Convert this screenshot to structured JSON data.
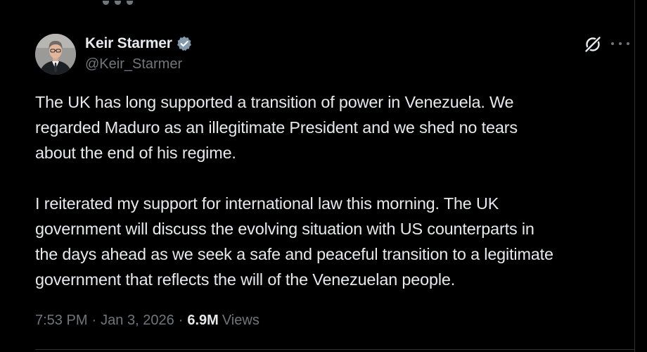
{
  "author": {
    "display_name": "Keir Starmer",
    "handle": "@Keir_Starmer",
    "verified": true,
    "avatar_icon": "profile-photo"
  },
  "header_icons": {
    "grok": "grok-icon",
    "more": "more-options-icon"
  },
  "tweet": {
    "paragraphs": [
      "The UK has long supported a transition of power in Venezuela. We\nregarded Maduro as an illegitimate President and we shed no tears\nabout the end of his regime.",
      "I reiterated my support for international law this morning. The UK\ngovernment will discuss the evolving situation with US counterparts in\nthe days ahead as we seek a safe and peaceful transition to a legitimate\ngovernment that reflects the will of the Venezuelan people."
    ]
  },
  "meta": {
    "time": "7:53 PM",
    "separator": "·",
    "date": "Jan 3, 2026",
    "views_count": "6.9M",
    "views_label": "Views"
  },
  "colors": {
    "background": "#000000",
    "text_primary": "#e7e9ea",
    "text_secondary": "#71767b",
    "verified_badge": "#829aab",
    "divider": "#2f3336"
  }
}
